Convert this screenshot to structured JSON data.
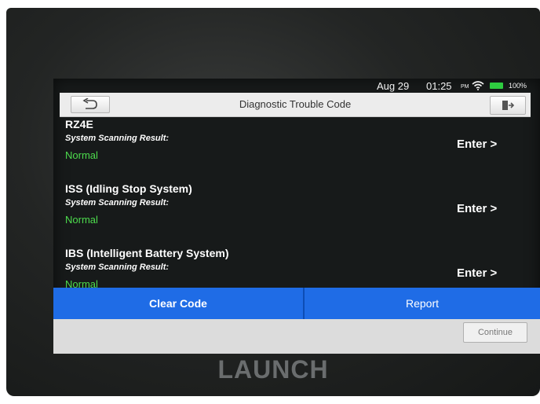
{
  "status_bar": {
    "date": "Aug 29",
    "time": "01:25",
    "ampm": "PM",
    "battery": "100%",
    "wifi_icon": "wifi-icon",
    "battery_icon": "battery-icon",
    "battery_color": "#2ecc40"
  },
  "header": {
    "title": "Diagnostic Trouble Code",
    "back_icon": "back-arrow-icon",
    "exit_icon": "exit-icon"
  },
  "systems": [
    {
      "name": "RZ4E",
      "scan_label": "System Scanning Result:",
      "result": "Normal",
      "enter_label": "Enter >"
    },
    {
      "name": "ISS (Idling Stop System)",
      "scan_label": "System Scanning Result:",
      "result": "Normal",
      "enter_label": "Enter >"
    },
    {
      "name": "IBS (Intelligent Battery System)",
      "scan_label": "System Scanning Result:",
      "result": "Normal",
      "enter_label": "Enter >"
    }
  ],
  "actions": {
    "clear_code": "Clear Code",
    "report": "Report",
    "accent_color": "#1f6ce6"
  },
  "footer": {
    "continue": "Continue"
  },
  "brand": {
    "logo": "LAUNCH"
  },
  "colors": {
    "normal_status": "#4ddc4d"
  }
}
